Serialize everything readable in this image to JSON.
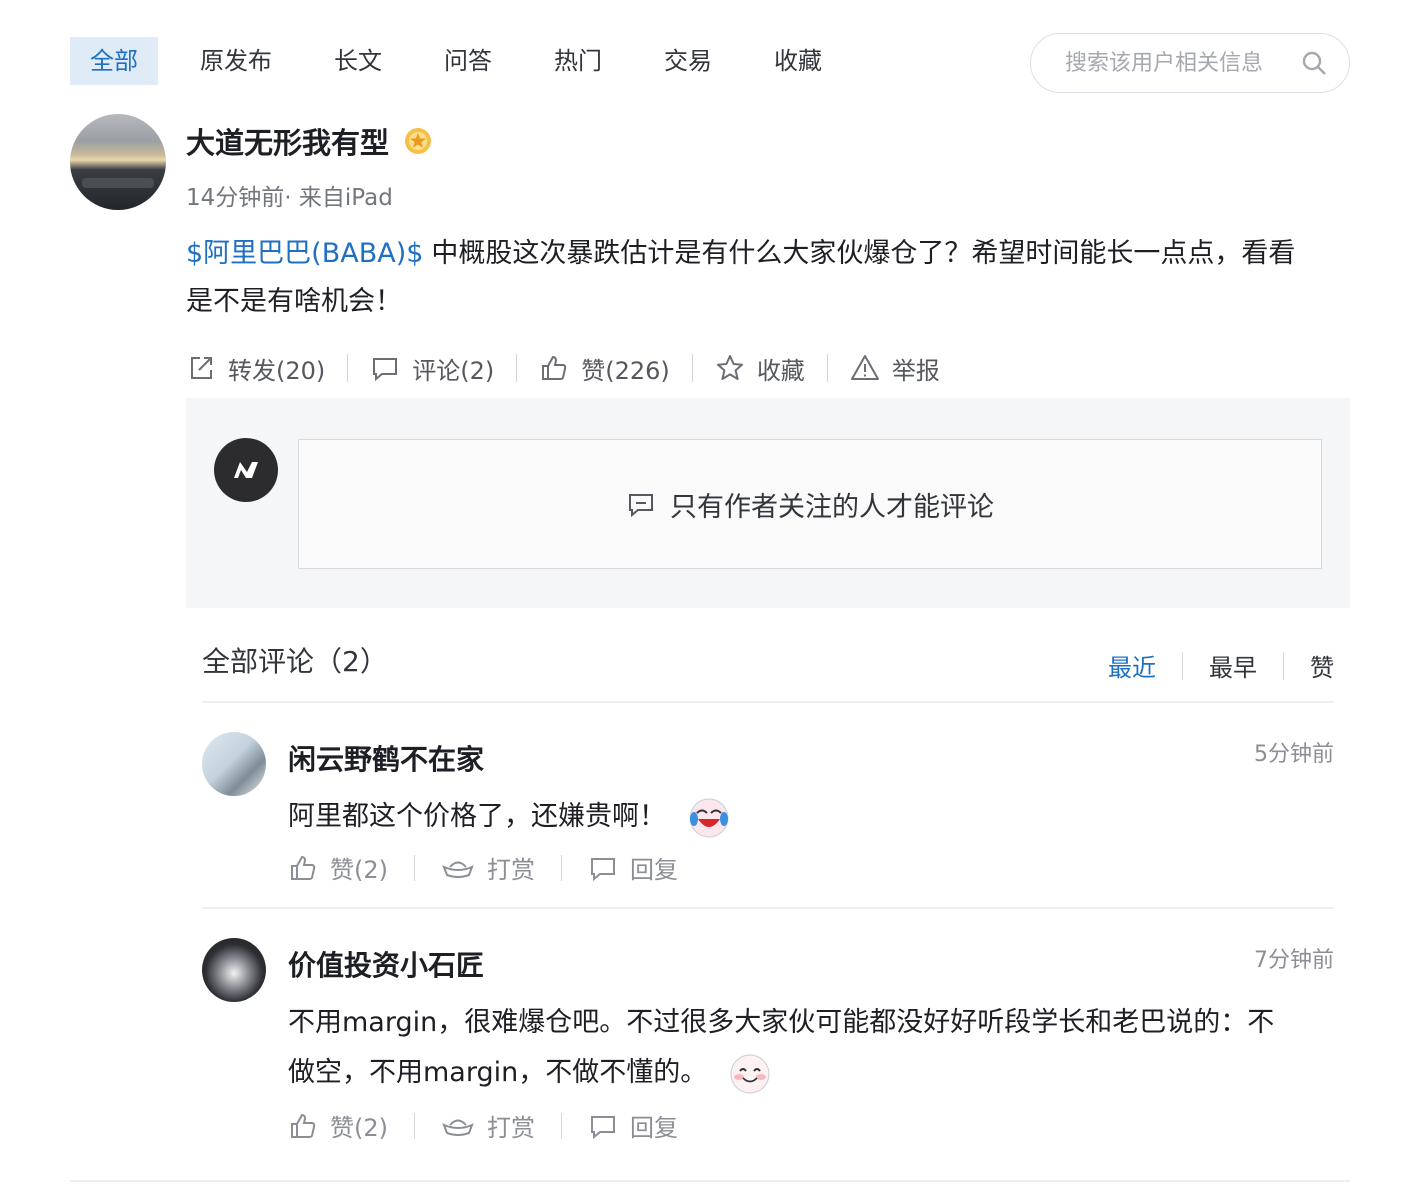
{
  "tabs": [
    {
      "label": "全部",
      "active": true
    },
    {
      "label": "原发布"
    },
    {
      "label": "长文"
    },
    {
      "label": "问答"
    },
    {
      "label": "热门"
    },
    {
      "label": "交易"
    },
    {
      "label": "收藏"
    }
  ],
  "search": {
    "placeholder": "搜索该用户相关信息",
    "icon": "search-icon"
  },
  "post": {
    "author": "大道无形我有型",
    "meta": "14分钟前· 来自iPad",
    "stock_tag": "$阿里巴巴(BABA)$",
    "text": "中概股这次暴跌估计是有什么大家伙爆仓了？希望时间能长一点点，看看是不是有啥机会！",
    "actions": {
      "repost": "转发(20)",
      "comment": "评论(2)",
      "like": "赞(226)",
      "favorite": "收藏",
      "report": "举报"
    }
  },
  "comment_box": {
    "notice": "只有作者关注的人才能评论"
  },
  "comments_header": {
    "title": "全部评论（2）",
    "sort": {
      "recent": "最近",
      "earliest": "最早",
      "likes": "赞"
    }
  },
  "comments": [
    {
      "name": "闲云野鹤不在家",
      "time": "5分钟前",
      "text": "阿里都这个价格了，还嫌贵啊！",
      "emoji": "laughing-tears-emoji",
      "like": "赞(2)",
      "tip": "打赏",
      "reply": "回复"
    },
    {
      "name": "价值投资小石匠",
      "time": "7分钟前",
      "text": "不用margin，很难爆仓吧。不过很多大家伙可能都没好好听段学长和老巴说的：不做空，不用margin，不做不懂的。",
      "emoji": "smile-emoji",
      "like": "赞(2)",
      "tip": "打赏",
      "reply": "回复"
    }
  ],
  "colors": {
    "accent": "#1f6fc3",
    "active_tab_bg": "#dfebf7",
    "muted": "#8b8e95"
  }
}
